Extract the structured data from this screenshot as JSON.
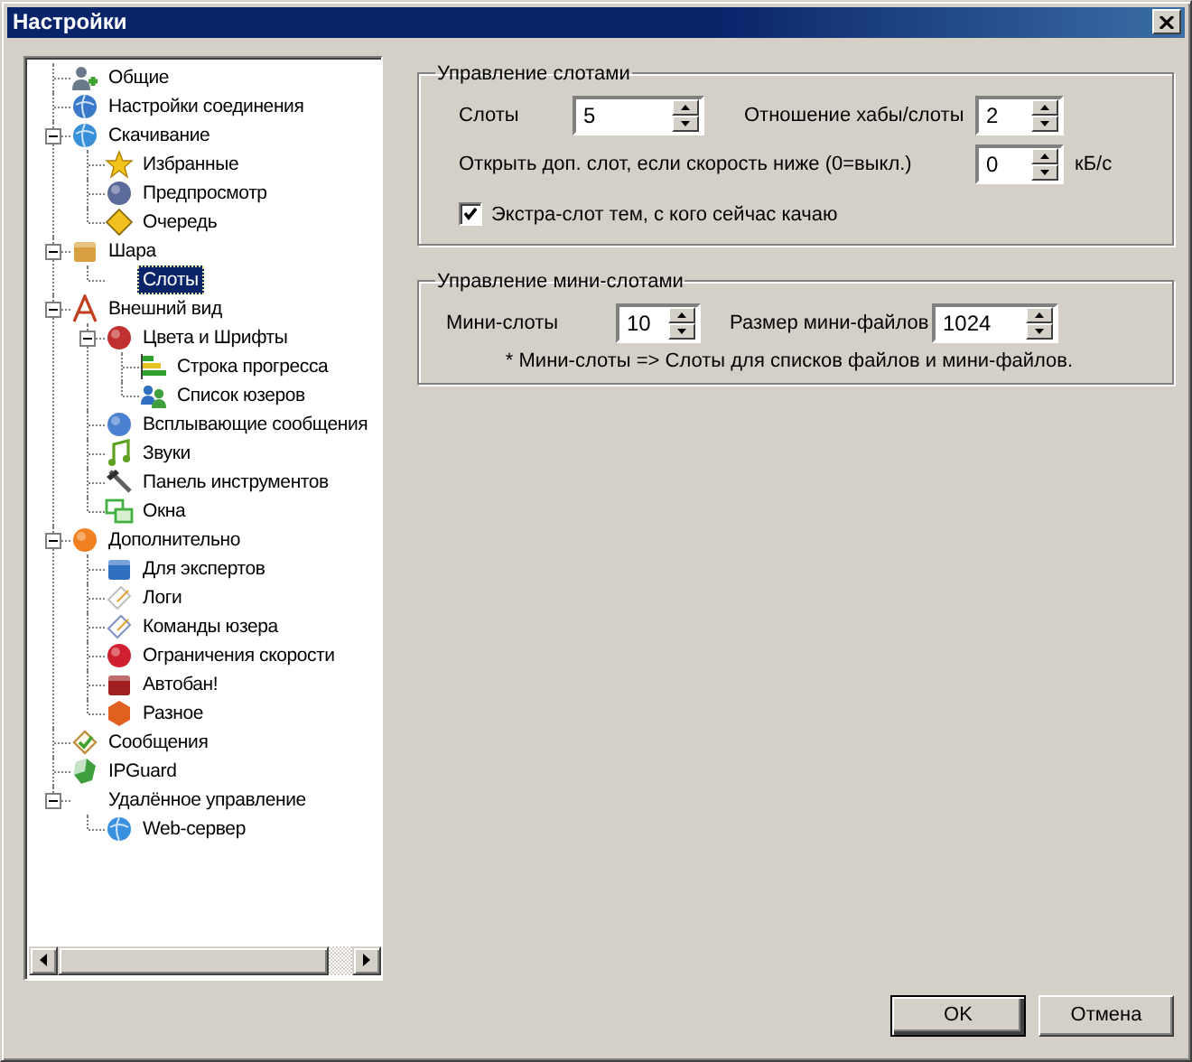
{
  "window": {
    "title": "Настройки"
  },
  "tree": [
    {
      "label": "Общие",
      "selected": false
    },
    {
      "label": "Настройки соединения",
      "selected": false
    },
    {
      "label": "Скачивание",
      "selected": false,
      "expanded": true,
      "children": [
        {
          "label": "Избранные",
          "selected": false
        },
        {
          "label": "Предпросмотр",
          "selected": false
        },
        {
          "label": "Очередь",
          "selected": false
        }
      ]
    },
    {
      "label": "Шара",
      "selected": false,
      "expanded": true,
      "children": [
        {
          "label": "Слоты",
          "selected": true
        }
      ]
    },
    {
      "label": "Внешний вид",
      "selected": false,
      "expanded": true,
      "children": [
        {
          "label": "Цвета и Шрифты",
          "selected": false,
          "expanded": true,
          "children": [
            {
              "label": "Строка прогресса",
              "selected": false
            },
            {
              "label": "Список юзеров",
              "selected": false
            }
          ]
        },
        {
          "label": "Всплывающие сообщения",
          "selected": false
        },
        {
          "label": "Звуки",
          "selected": false
        },
        {
          "label": "Панель инструментов",
          "selected": false
        },
        {
          "label": "Окна",
          "selected": false
        }
      ]
    },
    {
      "label": "Дополнительно",
      "selected": false,
      "expanded": true,
      "children": [
        {
          "label": "Для экспертов",
          "selected": false
        },
        {
          "label": "Логи",
          "selected": false
        },
        {
          "label": "Команды юзера",
          "selected": false
        },
        {
          "label": "Ограничения скорости",
          "selected": false
        },
        {
          "label": "Автобан!",
          "selected": false
        },
        {
          "label": "Разное",
          "selected": false
        }
      ]
    },
    {
      "label": "Сообщения",
      "selected": false
    },
    {
      "label": "IPGuard",
      "selected": false
    },
    {
      "label": "Удалённое управление",
      "selected": false,
      "expanded": true,
      "children": [
        {
          "label": "Web-сервер",
          "selected": false
        }
      ]
    }
  ],
  "slots_group": {
    "title": "Управление слотами",
    "fields": [
      {
        "label": "Слоты",
        "value": "5"
      },
      {
        "label": "Отношение хабы/слоты",
        "value": "2"
      }
    ],
    "extra_slot": {
      "label": "Открыть доп. слот, если скорость ниже (0=выкл.)",
      "value": "0",
      "unit": "кБ/с"
    },
    "checkbox": {
      "label": "Экстра-слот тем, с кого сейчас качаю",
      "checked": true
    }
  },
  "mini_slots_group": {
    "title": "Управление мини-слотами",
    "fields": [
      {
        "label": "Мини-слоты",
        "value": "10"
      },
      {
        "label": "Размер мини-файлов",
        "value": "1024"
      }
    ],
    "note": "* Мини-слоты => Слоты для списков файлов и мини-файлов."
  },
  "buttons": [
    {
      "label": "OK",
      "default": true
    },
    {
      "label": "Отмена",
      "default": false
    }
  ]
}
